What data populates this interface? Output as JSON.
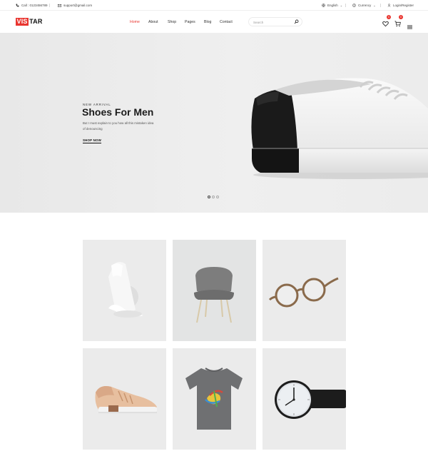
{
  "topbar": {
    "phone": "Call : 0123456789",
    "email": "support@gmail.com",
    "language": "English",
    "currency": "Currency",
    "account": "Login/Register"
  },
  "header": {
    "logo_red": "VIS",
    "logo_dark": "TAR",
    "nav": [
      "Home",
      "About",
      "Shop",
      "Pages",
      "Blog",
      "Contact"
    ],
    "active_nav": "Home",
    "search_placeholder": "Search",
    "wishlist_count": "0",
    "cart_count": "0"
  },
  "hero": {
    "subtitle": "NEW ARRIVAL",
    "title": "Shoes For Men",
    "description": "But I must explain to you how all this mistaken idea of denouncing",
    "cta": "SHOP NOW",
    "slides": 3,
    "active_slide": 1
  },
  "products": [
    {
      "name": "lamp",
      "bg": "#ebebeb"
    },
    {
      "name": "chair",
      "bg": "#e3e4e4"
    },
    {
      "name": "glasses",
      "bg": "#ebebeb"
    },
    {
      "name": "sneaker",
      "bg": "#ebebeb"
    },
    {
      "name": "t-shirt",
      "bg": "#ebebeb"
    },
    {
      "name": "watch",
      "bg": "#ebebeb"
    }
  ],
  "colors": {
    "accent": "#e9352f",
    "text": "#222222",
    "hero_bg": "#ececec"
  }
}
